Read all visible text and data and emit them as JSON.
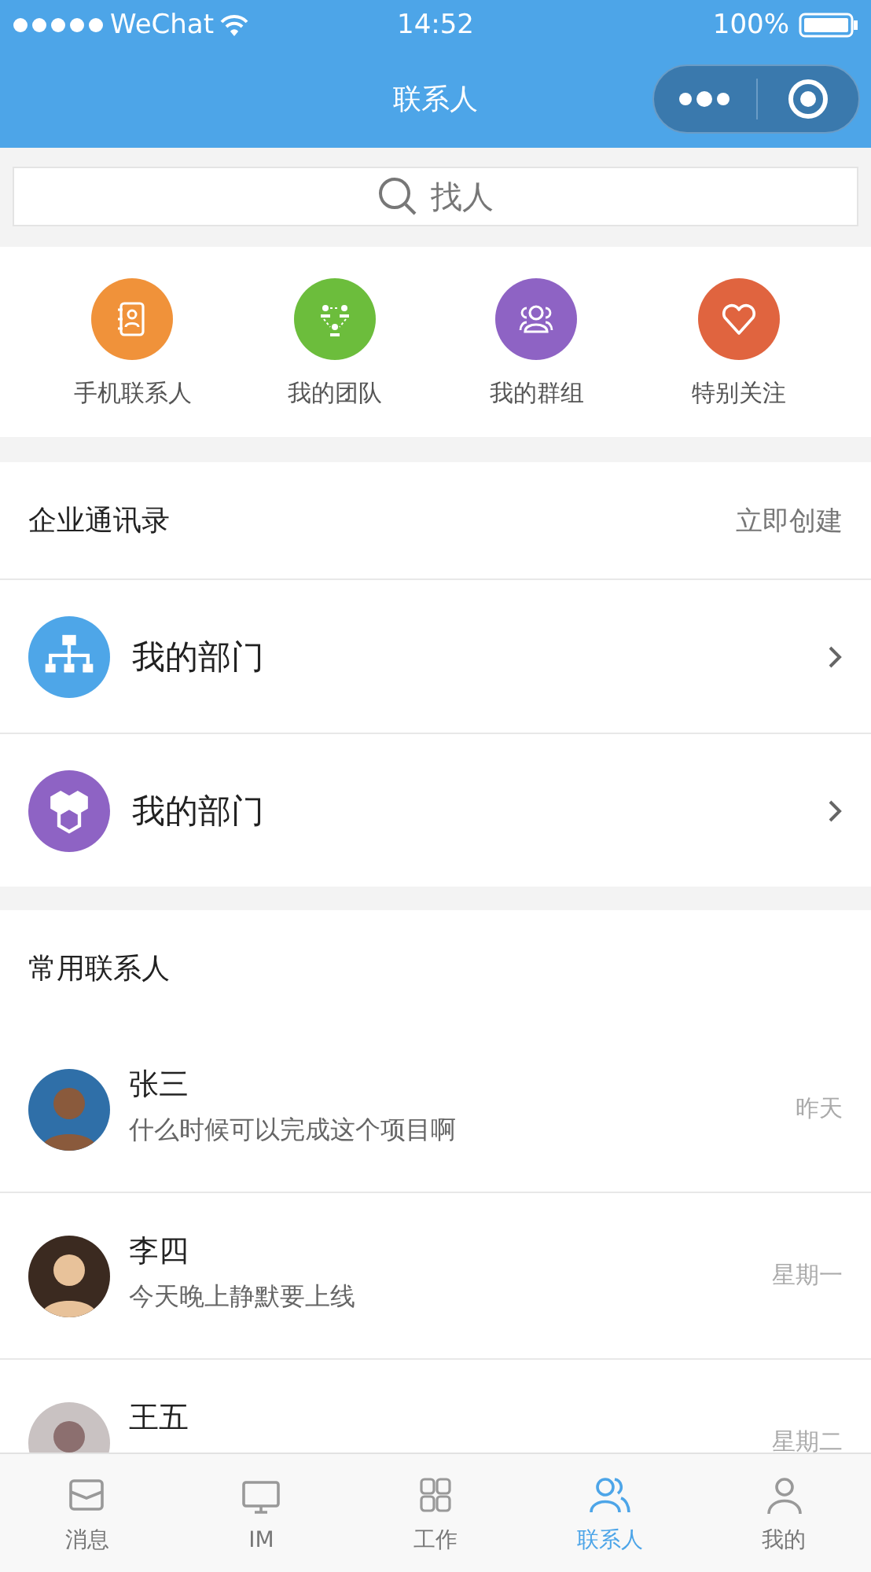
{
  "status_bar": {
    "carrier": "WeChat",
    "time": "14:52",
    "battery": "100%"
  },
  "nav": {
    "title": "联系人"
  },
  "search": {
    "placeholder": "找人"
  },
  "shortcuts": [
    {
      "label": "手机联系人",
      "color": "#f0923a"
    },
    {
      "label": "我的团队",
      "color": "#6cbd3c"
    },
    {
      "label": "我的群组",
      "color": "#8e63c4"
    },
    {
      "label": "特别关注",
      "color": "#e0643f"
    }
  ],
  "directory": {
    "title": "企业通讯录",
    "action": "立即创建",
    "items": [
      {
        "label": "我的部门",
        "color": "#4ea6e8"
      },
      {
        "label": "我的部门",
        "color": "#8e63c4"
      }
    ]
  },
  "frequent": {
    "title": "常用联系人",
    "contacts": [
      {
        "name": "张三",
        "message": "什么时候可以完成这个项目啊",
        "time": "昨天"
      },
      {
        "name": "李四",
        "message": "今天晚上静默要上线",
        "time": "星期一"
      },
      {
        "name": "王五",
        "time": "星期二"
      }
    ]
  },
  "tabs": [
    {
      "label": "消息",
      "selected": false
    },
    {
      "label": "IM",
      "selected": false
    },
    {
      "label": "工作",
      "selected": false
    },
    {
      "label": "联系人",
      "selected": true
    },
    {
      "label": "我的",
      "selected": false
    }
  ]
}
